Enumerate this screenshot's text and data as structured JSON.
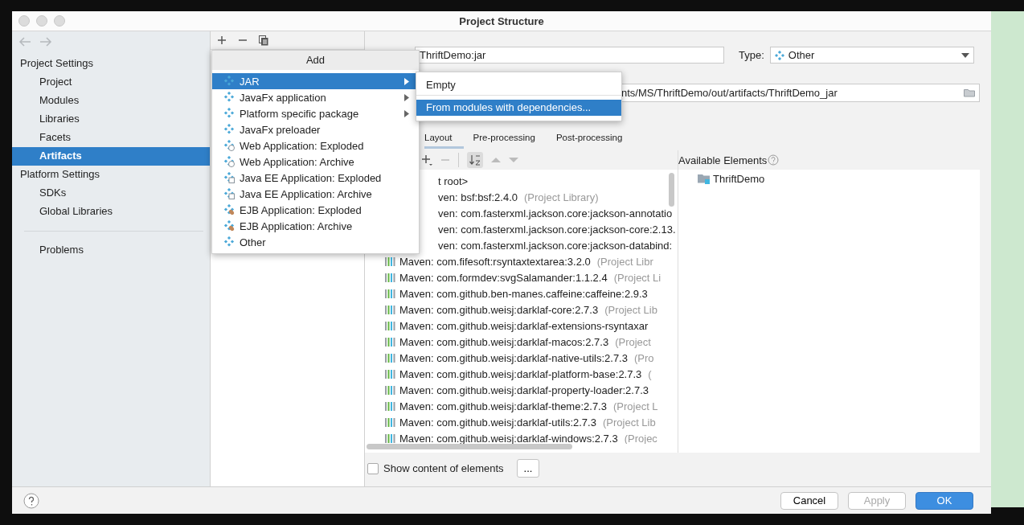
{
  "window": {
    "title": "Project Structure"
  },
  "sidebar": {
    "groups": [
      {
        "title": "Project Settings",
        "items": [
          {
            "label": "Project",
            "selected": false
          },
          {
            "label": "Modules",
            "selected": false
          },
          {
            "label": "Libraries",
            "selected": false
          },
          {
            "label": "Facets",
            "selected": false
          },
          {
            "label": "Artifacts",
            "selected": true
          }
        ]
      },
      {
        "title": "Platform Settings",
        "items": [
          {
            "label": "SDKs",
            "selected": false
          },
          {
            "label": "Global Libraries",
            "selected": false
          }
        ]
      }
    ],
    "bottom_items": [
      {
        "label": "Problems",
        "selected": false
      }
    ]
  },
  "add_menu": {
    "title": "Add",
    "items": [
      {
        "label": "JAR",
        "kind": "plain",
        "submenu": true,
        "selected": true
      },
      {
        "label": "JavaFx application",
        "kind": "plain",
        "submenu": true,
        "selected": false
      },
      {
        "label": "Platform specific package",
        "kind": "plain",
        "submenu": true,
        "selected": false
      },
      {
        "label": "JavaFx preloader",
        "kind": "plain",
        "submenu": false,
        "selected": false
      },
      {
        "label": "Web Application: Exploded",
        "kind": "web",
        "submenu": false,
        "selected": false
      },
      {
        "label": "Web Application: Archive",
        "kind": "web",
        "submenu": false,
        "selected": false
      },
      {
        "label": "Java EE Application: Exploded",
        "kind": "ee",
        "submenu": false,
        "selected": false
      },
      {
        "label": "Java EE Application: Archive",
        "kind": "ee",
        "submenu": false,
        "selected": false
      },
      {
        "label": "EJB Application: Exploded",
        "kind": "ejb",
        "submenu": false,
        "selected": false
      },
      {
        "label": "EJB Application: Archive",
        "kind": "ejb",
        "submenu": false,
        "selected": false
      },
      {
        "label": "Other",
        "kind": "plain",
        "submenu": false,
        "selected": false
      }
    ]
  },
  "submenu": {
    "items": [
      {
        "label": "Empty",
        "selected": false
      },
      {
        "label": "From modules with dependencies...",
        "selected": true
      }
    ]
  },
  "artifact": {
    "name": "ThriftDemo:jar",
    "type_label": "Type:",
    "type": "Other",
    "output_directory": "nts/MS/ThriftDemo/out/artifacts/ThriftDemo_jar"
  },
  "tabs": [
    {
      "label": "Layout",
      "selected": true
    },
    {
      "label": "Pre-processing",
      "selected": false
    },
    {
      "label": "Post-processing",
      "selected": false
    }
  ],
  "layout_tree": [
    {
      "kind": "clipped",
      "text": "t root>"
    },
    {
      "kind": "clipped",
      "text": "ven: bsf:bsf:2.4.0",
      "note": "(Project Library)"
    },
    {
      "kind": "clipped",
      "text": "ven: com.fasterxml.jackson.core:jackson-annotatio"
    },
    {
      "kind": "clipped",
      "text": "ven: com.fasterxml.jackson.core:jackson-core:2.13."
    },
    {
      "kind": "clipped",
      "text": "ven: com.fasterxml.jackson.core:jackson-databind:"
    },
    {
      "kind": "library",
      "text": "Maven: com.fifesoft:rsyntaxtextarea:3.2.0",
      "note": "(Project Libr"
    },
    {
      "kind": "library",
      "text": "Maven: com.formdev:svgSalamander:1.1.2.4",
      "note": "(Project Li"
    },
    {
      "kind": "library",
      "text": "Maven: com.github.ben-manes.caffeine:caffeine:2.9.3"
    },
    {
      "kind": "library",
      "text": "Maven: com.github.weisj:darklaf-core:2.7.3",
      "note": "(Project Lib"
    },
    {
      "kind": "library",
      "text": "Maven: com.github.weisj:darklaf-extensions-rsyntaxar"
    },
    {
      "kind": "library",
      "text": "Maven: com.github.weisj:darklaf-macos:2.7.3",
      "note": "(Project"
    },
    {
      "kind": "library",
      "text": "Maven: com.github.weisj:darklaf-native-utils:2.7.3",
      "note": "(Pro"
    },
    {
      "kind": "library",
      "text": "Maven: com.github.weisj:darklaf-platform-base:2.7.3",
      "note": "("
    },
    {
      "kind": "library",
      "text": "Maven: com.github.weisj:darklaf-property-loader:2.7.3"
    },
    {
      "kind": "library",
      "text": "Maven: com.github.weisj:darklaf-theme:2.7.3",
      "note": "(Project L"
    },
    {
      "kind": "library",
      "text": "Maven: com.github.weisj:darklaf-utils:2.7.3",
      "note": "(Project Lib"
    },
    {
      "kind": "library",
      "text": "Maven: com.github.weisj:darklaf-windows:2.7.3",
      "note": "(Projec"
    }
  ],
  "available": {
    "title": "Available Elements",
    "items": [
      {
        "label": "ThriftDemo"
      }
    ]
  },
  "show_content": {
    "label": "Show content of elements",
    "checked": false,
    "more_button": "..."
  },
  "footer": {
    "buttons": [
      {
        "label": "Cancel",
        "kind": "normal"
      },
      {
        "label": "Apply",
        "kind": "disabled"
      },
      {
        "label": "OK",
        "kind": "default"
      }
    ]
  }
}
